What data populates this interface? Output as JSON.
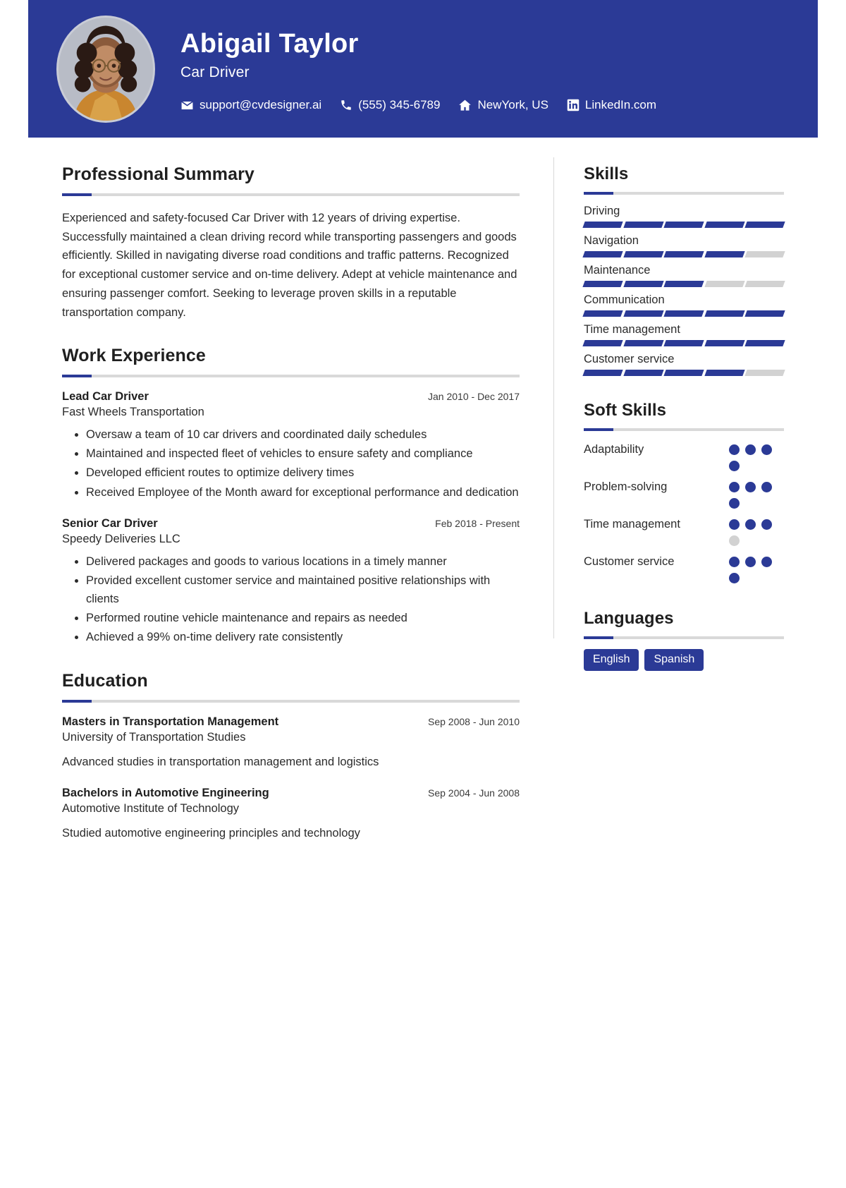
{
  "header": {
    "name": "Abigail Taylor",
    "role": "Car Driver",
    "avatar_alt": "profile-photo",
    "contacts": [
      {
        "icon": "email-icon",
        "text": "support@cvdesigner.ai"
      },
      {
        "icon": "phone-icon",
        "text": "(555) 345-6789"
      },
      {
        "icon": "home-icon",
        "text": "NewYork, US"
      },
      {
        "icon": "linkedin-icon",
        "text": "LinkedIn.com"
      }
    ]
  },
  "summary": {
    "heading": "Professional Summary",
    "text": "Experienced and safety-focused Car Driver with 12 years of driving expertise. Successfully maintained a clean driving record while transporting passengers and goods efficiently. Skilled in navigating diverse road conditions and traffic patterns. Recognized for exceptional customer service and on-time delivery. Adept at vehicle maintenance and ensuring passenger comfort. Seeking to leverage proven skills in a reputable transportation company."
  },
  "work": {
    "heading": "Work Experience",
    "entries": [
      {
        "title": "Lead Car Driver",
        "date": "Jan 2010 - Dec 2017",
        "org": "Fast Wheels Transportation",
        "bullets": [
          "Oversaw a team of 10 car drivers and coordinated daily schedules",
          "Maintained and inspected fleet of vehicles to ensure safety and compliance",
          "Developed efficient routes to optimize delivery times",
          "Received Employee of the Month award for exceptional performance and dedication"
        ]
      },
      {
        "title": "Senior Car Driver",
        "date": "Feb 2018 - Present",
        "org": "Speedy Deliveries LLC",
        "bullets": [
          "Delivered packages and goods to various locations in a timely manner",
          "Provided excellent customer service and maintained positive relationships with clients",
          "Performed routine vehicle maintenance and repairs as needed",
          "Achieved a 99% on-time delivery rate consistently"
        ]
      }
    ]
  },
  "education": {
    "heading": "Education",
    "entries": [
      {
        "title": "Masters in Transportation Management",
        "date": "Sep 2008 - Jun 2010",
        "org": "University of Transportation Studies",
        "desc": "Advanced studies in transportation management and logistics"
      },
      {
        "title": "Bachelors in Automotive Engineering",
        "date": "Sep 2004 - Jun 2008",
        "org": "Automotive Institute of Technology",
        "desc": "Studied automotive engineering principles and technology"
      }
    ]
  },
  "skills": {
    "heading": "Skills",
    "max": 5,
    "items": [
      {
        "label": "Driving",
        "level": 5
      },
      {
        "label": "Navigation",
        "level": 4
      },
      {
        "label": "Maintenance",
        "level": 3
      },
      {
        "label": "Communication",
        "level": 5
      },
      {
        "label": "Time management",
        "level": 5
      },
      {
        "label": "Customer service",
        "level": 4
      }
    ]
  },
  "soft_skills": {
    "heading": "Soft Skills",
    "max": 4,
    "items": [
      {
        "label": "Adaptability",
        "level": 4
      },
      {
        "label": "Problem-solving",
        "level": 4
      },
      {
        "label": "Time management",
        "level": 3
      },
      {
        "label": "Customer service",
        "level": 4
      }
    ]
  },
  "languages": {
    "heading": "Languages",
    "items": [
      "English",
      "Spanish"
    ]
  },
  "colors": {
    "accent": "#2b3a96",
    "muted": "#d2d2d2",
    "rule": "#d9d9d9",
    "text": "#2b2b2b"
  }
}
